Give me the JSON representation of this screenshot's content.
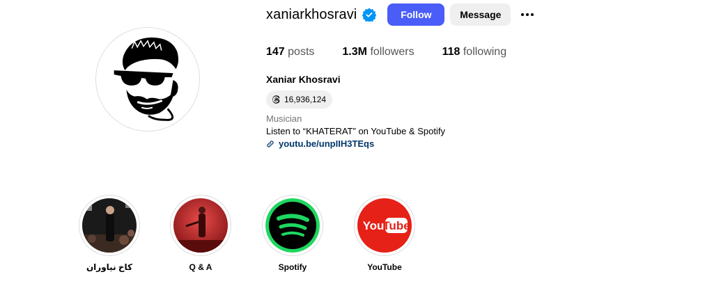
{
  "profile": {
    "username": "xaniarkhosravi",
    "verified": true,
    "follow_label": "Follow",
    "message_label": "Message",
    "full_name": "Xaniar Khosravi",
    "threads_count": "16,936,124",
    "category": "Musician",
    "bio": "Listen to “KHATERAT” on YouTube & Spotify",
    "link": "youtu.be/unpIIH3TEqs"
  },
  "stats": {
    "posts_count": "147",
    "posts_label": "posts",
    "followers_count": "1.3M",
    "followers_label": "followers",
    "following_count": "118",
    "following_label": "following"
  },
  "highlights": [
    {
      "label": "کاخ نیاوران",
      "icon": "concert-photo"
    },
    {
      "label": "Q & A",
      "icon": "stage-photo"
    },
    {
      "label": "Spotify",
      "icon": "spotify-logo"
    },
    {
      "label": "YouTube",
      "icon": "youtube-logo"
    }
  ],
  "colors": {
    "follow_button": "#4a5df9",
    "verified_badge": "#0095f6",
    "link": "#00376b",
    "spotify_green": "#1ed760",
    "youtube_red": "#e62117"
  }
}
